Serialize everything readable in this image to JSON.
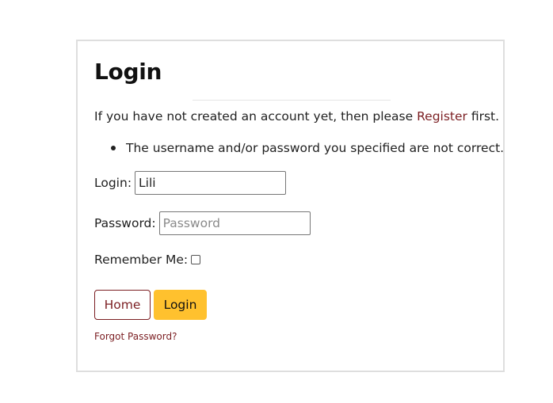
{
  "title": "Login",
  "intro": {
    "before": "If you have not created an account yet, then please ",
    "link": "Register",
    "after": " first."
  },
  "errors": [
    "The username and/or password you specified are not correct."
  ],
  "form": {
    "login_label": "Login:",
    "login_value": "Lili",
    "password_label": "Password:",
    "password_placeholder": "Password",
    "remember_label": "Remember Me:",
    "remember_checked": false
  },
  "buttons": {
    "home": "Home",
    "login": "Login"
  },
  "forgot_link": "Forgot Password?",
  "colors": {
    "link": "#7b1e22",
    "primary_button": "#ffc12e",
    "card_border": "#dedede"
  }
}
